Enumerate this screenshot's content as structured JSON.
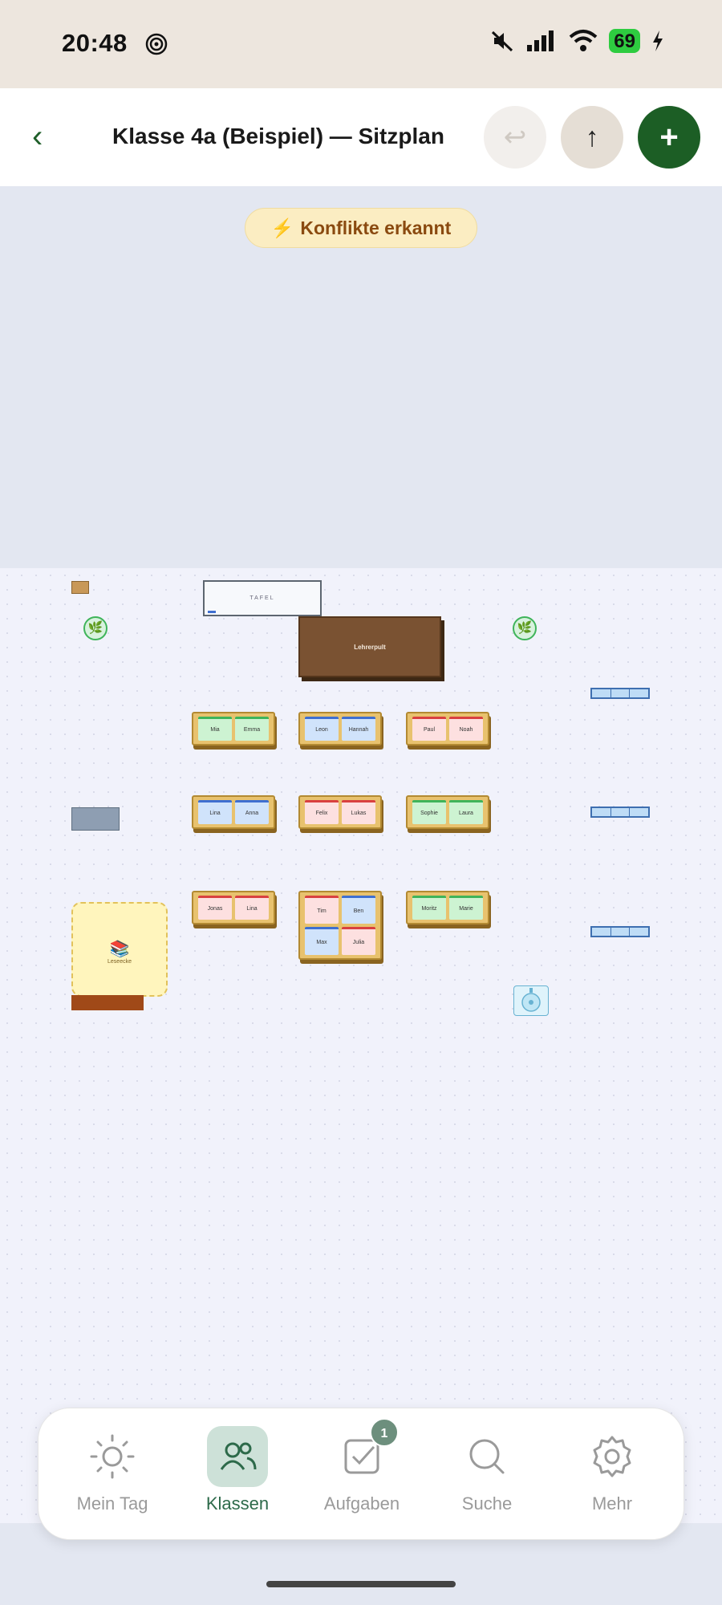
{
  "status_bar": {
    "time": "20:48",
    "battery": "69"
  },
  "header": {
    "back": "‹",
    "title": "Klasse 4a (Beispiel) — Sitzplan",
    "undo_icon": "↩",
    "up_icon": "↑",
    "add_icon": "+"
  },
  "banner": {
    "icon": "⚡",
    "text": "Konflikte erkannt"
  },
  "room": {
    "board_label": "TAFEL",
    "teacher_desk_label": "Lehrerpult",
    "reading_corner_label": "Leseecke",
    "plant_icon": "🌿",
    "books_icon": "📚"
  },
  "desks": [
    {
      "seats": [
        {
          "name": "Mia",
          "color": "green"
        },
        {
          "name": "Emma",
          "color": "green"
        }
      ]
    },
    {
      "seats": [
        {
          "name": "Leon",
          "color": "blue"
        },
        {
          "name": "Hannah",
          "color": "blue"
        }
      ]
    },
    {
      "seats": [
        {
          "name": "Paul",
          "color": "red"
        },
        {
          "name": "Noah",
          "color": "red"
        }
      ]
    },
    {
      "seats": [
        {
          "name": "Lina",
          "color": "blue"
        },
        {
          "name": "Anna",
          "color": "blue"
        }
      ]
    },
    {
      "seats": [
        {
          "name": "Felix",
          "color": "red"
        },
        {
          "name": "Lukas",
          "color": "red"
        }
      ]
    },
    {
      "seats": [
        {
          "name": "Sophie",
          "color": "green"
        },
        {
          "name": "Laura",
          "color": "green"
        }
      ]
    },
    {
      "seats": [
        {
          "name": "Jonas",
          "color": "red"
        },
        {
          "name": "Lina",
          "color": "red"
        }
      ]
    },
    {
      "seats": [
        {
          "name": "Tim",
          "color": "red"
        },
        {
          "name": "Ben",
          "color": "blue"
        },
        {
          "name": "Max",
          "color": "blue"
        },
        {
          "name": "Julia",
          "color": "red"
        }
      ]
    },
    {
      "seats": [
        {
          "name": "Moritz",
          "color": "green"
        },
        {
          "name": "Marie",
          "color": "green"
        }
      ]
    }
  ],
  "nav": {
    "items": [
      {
        "label": "Mein Tag",
        "icon": "sun-icon"
      },
      {
        "label": "Klassen",
        "icon": "users-icon"
      },
      {
        "label": "Aufgaben",
        "icon": "checkbox-icon",
        "badge": "1"
      },
      {
        "label": "Suche",
        "icon": "search-icon"
      },
      {
        "label": "Mehr",
        "icon": "gear-icon"
      }
    ]
  },
  "colors": {
    "accent": "#1c5e25",
    "active_nav": "#2d6a4a",
    "banner_bg": "#fbedc2"
  }
}
